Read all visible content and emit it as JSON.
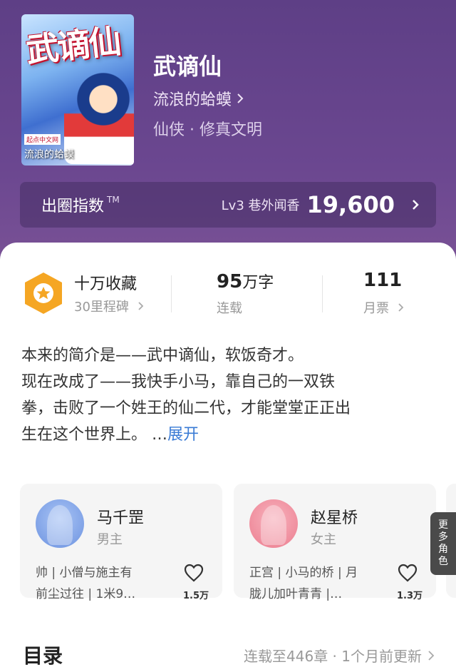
{
  "book": {
    "cover_title": "武谪仙",
    "cover_stamp": "起点中文网",
    "cover_author": "流浪的蛤蟆",
    "title": "武谪仙",
    "author": "流浪的蛤蟆",
    "genre": "仙侠 · 修真文明"
  },
  "index": {
    "label": "出圈指数",
    "tm": "TM",
    "level": "Lv3 巷外闻香",
    "score": "19,600"
  },
  "stats": {
    "collect_title": "十万收藏",
    "collect_sub": "30里程碑",
    "words_value": "95",
    "words_unit": "万字",
    "words_sub": "连载",
    "tickets_value": "111",
    "tickets_sub": "月票"
  },
  "synopsis": {
    "line1": "本来的简介是——武中谪仙，软饭奇才。",
    "line2": "现在改成了——我快手小马，靠自己的一双铁",
    "line3": "拳，击败了一个姓王的仙二代，才能堂堂正正出",
    "line4": "生在这个世界上。 …",
    "expand": "展开"
  },
  "roles": [
    {
      "name": "马千罡",
      "type": "男主",
      "desc1": "帅 | 小僧与施主有",
      "desc2": "前尘过往 | 1米9…",
      "likes": "1.5万",
      "avatar_color": "#7fa6e8"
    },
    {
      "name": "赵星桥",
      "type": "女主",
      "desc1": "正宫 | 小马的桥 | 月",
      "desc2": "胧儿加叶青青 |…",
      "likes": "1.3万",
      "avatar_color": "#f08a9a"
    }
  ],
  "more_roles": [
    "更",
    "多",
    "角",
    "色"
  ],
  "toc": {
    "title": "目录",
    "info": "连载至446章 · 1个月前更新"
  },
  "colors": {
    "accent_badge": "#f5a623",
    "link": "#3a7bd5"
  }
}
